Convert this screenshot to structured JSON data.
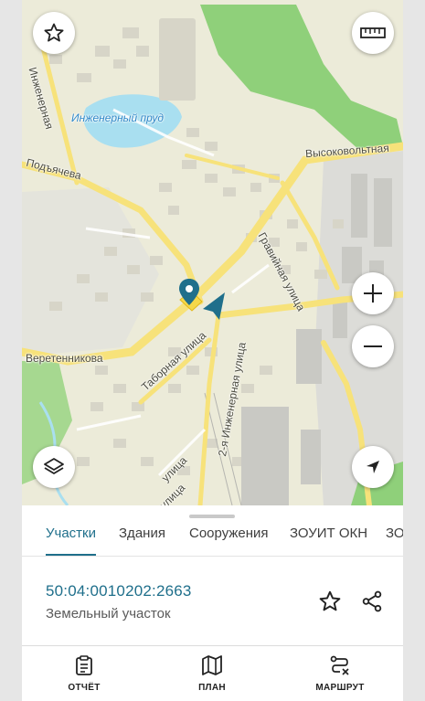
{
  "map": {
    "pond_label": "Инженерный пруд",
    "streets": {
      "vysokovoltnaya": "Высоковольтная",
      "gravijnaya": "Гравийная улица",
      "inzhenernaya": "Инженерная",
      "podyacheva": "Подъячева",
      "veretennikova": "Веретенникова",
      "tabornaya": "Таборная улица",
      "inzhenernaya2": "2-я Инженерная улица",
      "ulitsa_bottom": "улица",
      "ulitsa_bottom2": "улица"
    },
    "colors": {
      "water": "#a9dff0",
      "park": "#8fd07a",
      "road": "#f7e27a",
      "pin": "#1f6f8b"
    }
  },
  "tabs": [
    {
      "label": "Участки",
      "active": true
    },
    {
      "label": "Здания",
      "active": false
    },
    {
      "label": "Сооружения",
      "active": false
    },
    {
      "label": "ЗОУИТ ОКН",
      "active": false
    },
    {
      "label": "ЗО",
      "active": false
    }
  ],
  "selected": {
    "cadastral_number": "50:04:0010202:2663",
    "type": "Земельный участок"
  },
  "nav": {
    "report": "ОТЧЁТ",
    "plan": "ПЛАН",
    "route": "МАРШРУТ"
  }
}
